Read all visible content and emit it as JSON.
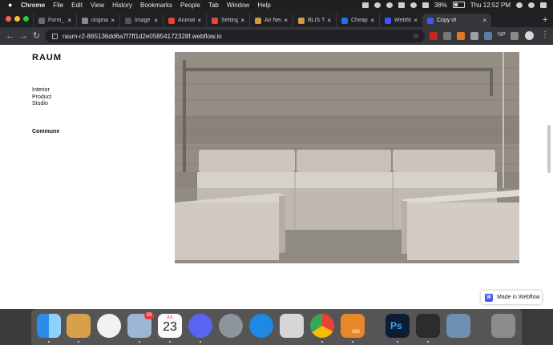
{
  "menubar": {
    "app": "Chrome",
    "items": [
      "File",
      "Edit",
      "View",
      "History",
      "Bookmarks",
      "People",
      "Tab",
      "Window",
      "Help"
    ],
    "battery": "38%",
    "clock": "Thu 12:52 PM"
  },
  "tabs": [
    {
      "title": "Form_ —",
      "color": "#6b6b6b"
    },
    {
      "title": "original_",
      "color": "#8a8a8a"
    },
    {
      "title": "Image C",
      "color": "#555555"
    },
    {
      "title": "Animati",
      "color": "#ea4335"
    },
    {
      "title": "Settings",
      "color": "#ea4335"
    },
    {
      "title": "Air New",
      "color": "#d59a3c"
    },
    {
      "title": "BLIS Te",
      "color": "#d59a3c"
    },
    {
      "title": "Cheap F",
      "color": "#1a73e8"
    },
    {
      "title": "Webflow",
      "color": "#4353ff"
    },
    {
      "title": "Copy of",
      "color": "#4353ff",
      "active": true
    }
  ],
  "toolbar": {
    "url": "raum-r2-865136dd6a7f7ff1d2e05854172328f.webflow.io",
    "ext_label": "NP"
  },
  "page": {
    "logo": "RAUM",
    "nav": [
      "Interior",
      "Product",
      "Studio"
    ],
    "section": "Commune",
    "badge": "Made in Webflow"
  },
  "dock": {
    "calendar_month": "JUL",
    "calendar_day": "23",
    "mail_badge": "59",
    "fusion_label": "360"
  }
}
